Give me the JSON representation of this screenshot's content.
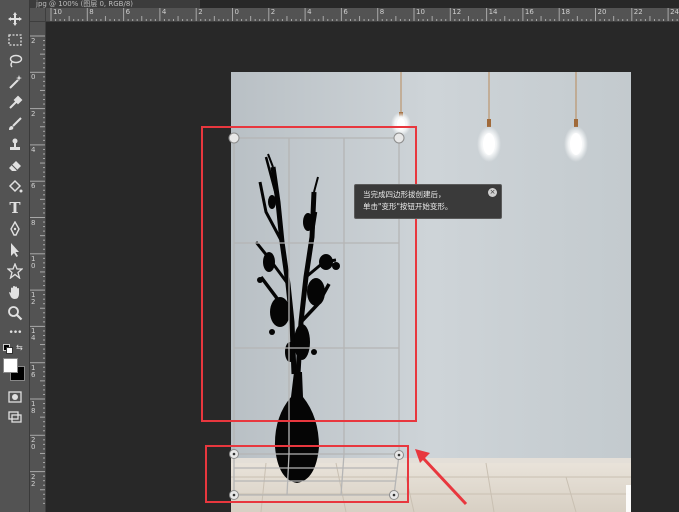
{
  "document_tab": {
    "title": "jpg @ 100% (图层 0, RGB/8)"
  },
  "toolbar": {
    "tools": [
      {
        "name": "move-tool",
        "icon": "move-icon"
      },
      {
        "name": "marquee-tool",
        "icon": "marquee-icon"
      },
      {
        "name": "lasso-tool",
        "icon": "lasso-icon"
      },
      {
        "name": "magic-wand-tool",
        "icon": "magic-wand-icon"
      },
      {
        "name": "eyedropper-tool",
        "icon": "eyedropper-icon"
      },
      {
        "name": "brush-tool",
        "icon": "brush-icon"
      },
      {
        "name": "stamp-tool",
        "icon": "stamp-icon"
      },
      {
        "name": "eraser-tool",
        "icon": "eraser-icon"
      },
      {
        "name": "paint-bucket-tool",
        "icon": "paint-bucket-icon"
      },
      {
        "name": "type-tool",
        "icon": "type-icon"
      },
      {
        "name": "pen-tool",
        "icon": "pen-icon"
      },
      {
        "name": "path-selection-tool",
        "icon": "arrow-icon"
      },
      {
        "name": "custom-shape-tool",
        "icon": "shape-icon"
      },
      {
        "name": "hand-tool",
        "icon": "hand-icon"
      },
      {
        "name": "zoom-tool",
        "icon": "zoom-icon"
      },
      {
        "name": "more-tools",
        "icon": "ellipsis-icon"
      }
    ],
    "type_tool_glyph": "T",
    "more_glyph": "•••",
    "foreground_color": "#ffffff",
    "background_color": "#000000"
  },
  "rulers": {
    "horizontal_labels": [
      "10",
      "8",
      "6",
      "4",
      "2",
      "0",
      "2",
      "4",
      "6",
      "8",
      "10",
      "12",
      "14",
      "16",
      "18",
      "20",
      "22",
      "24"
    ],
    "vertical_labels": [
      "2",
      "0",
      "2",
      "4",
      "6",
      "8",
      "1 0",
      "1 2",
      "1 4",
      "1 6",
      "1 8",
      "2 0",
      "2 2"
    ]
  },
  "tooltip": {
    "line1": "当完成四边形拔创建后，",
    "line2": "单击\"变形\"按钮开始变形。",
    "close_glyph": "×"
  },
  "colors": {
    "wall": "#c9cfd3",
    "floor": "#e6e0d6",
    "highlight_box": "#e8373e",
    "tooltip_bg": "#3a3a3a"
  }
}
